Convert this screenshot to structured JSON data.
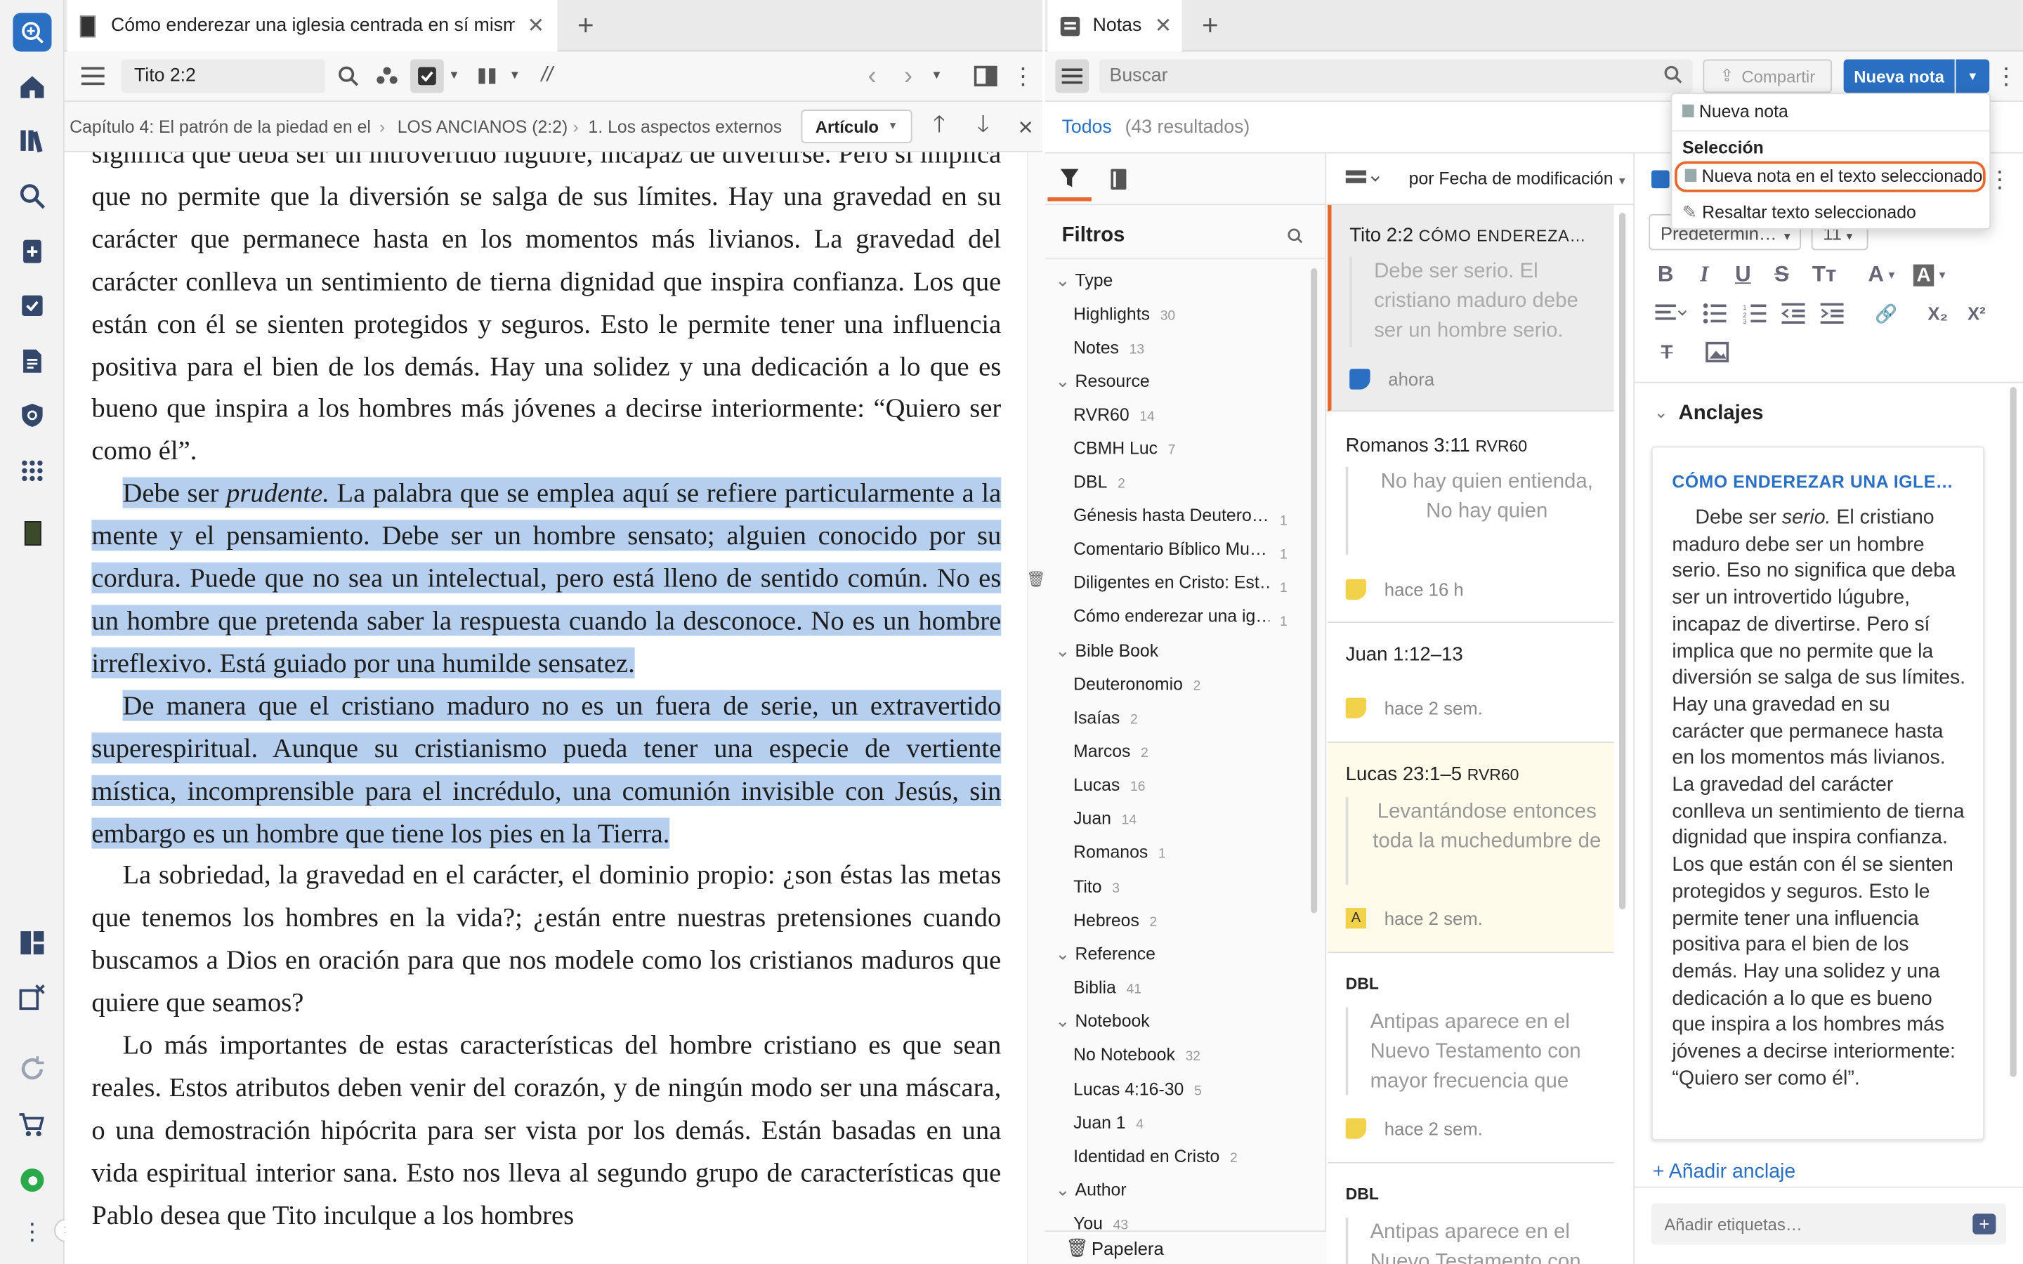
{
  "left_tab": {
    "title": "Cómo enderezar una iglesia centrada en sí misma"
  },
  "reader_toolbar": {
    "reference": "Tito 2:2",
    "parallel": "//"
  },
  "breadcrumb": {
    "items": [
      "Capítulo 4: El patrón de la piedad en el",
      "LOS ANCIANOS (2:2)",
      "1. Los aspectos externos"
    ],
    "view_select": "Artículo"
  },
  "reader": {
    "p1": "significa que deba ser un introvertido lúgubre, incapaz de divertirse. Pero si implica que no permite que la diversión se salga de sus límites. Hay una gravedad en su carácter que permanece hasta en los momentos más livianos. La gravedad del carácter conlleva un sentimiento de tierna dignidad que inspira confianza. Los que están con él se sienten protegidos y seguros. Esto le permite tener una influencia positiva para el bien de los demás. Hay una solidez y una dedicación a lo que es bueno que inspira a los hombres más jóvenes a decirse interiormente: “Quiero ser como él”.",
    "p2a": "Debe ser ",
    "p2em": "prudente.",
    "p2b": " La palabra que se emplea aquí se refiere particularmente a la mente y el pensamiento. Debe ser un hombre sensato; alguien conocido por su cordura. Puede que no sea un intelectual, pero está lleno de sentido común. No es un hombre que pretenda saber la respuesta cuando la desconoce. No es un hombre irreflexivo. Está guiado por una humilde sensatez.",
    "p3": "De manera que el cristiano maduro no es un fuera de serie, un extravertido superespiritual. Aunque su cristianismo pueda tener una especie de vertiente mística, incomprensible para el incrédulo, una comunión invisible con Jesús, sin embargo es un hombre que tiene los pies en la Tierra.",
    "p4": "La sobriedad, la gravedad en el carácter, el dominio propio: ¿son éstas las metas que tenemos los hombres en la vida?; ¿están entre nuestras pretensiones cuando buscamos a Dios en oración para que nos modele como los cristianos maduros que quiere que seamos?",
    "p5": "Lo más importantes de estas características del hombre cristiano es que sean reales. Estos atributos deben venir del corazón, y de ningún modo ser una máscara, o una demostración hipócrita para ser vista por los demás. Están basadas en una vida espiritual interior sana. Esto nos lleva al segundo grupo de características que Pablo desea que Tito inculque a los hombres"
  },
  "notes_tab": {
    "title": "Notas"
  },
  "notes_toolbar": {
    "search_placeholder": "Buscar",
    "share": "Compartir",
    "new_note": "Nueva nota"
  },
  "notes_header": {
    "all": "Todos",
    "results": "(43 resultados)"
  },
  "sort": {
    "label": "por Fecha de modificación"
  },
  "filters": {
    "title": "Filtros",
    "groups": [
      {
        "name": "Type",
        "items": [
          {
            "label": "Highlights",
            "count": "30"
          },
          {
            "label": "Notes",
            "count": "13"
          }
        ]
      },
      {
        "name": "Resource",
        "items": [
          {
            "label": "RVR60",
            "count": "14"
          },
          {
            "label": "CBMH Luc",
            "count": "7"
          },
          {
            "label": "DBL",
            "count": "2"
          },
          {
            "label": "Génesis hasta Deutero…",
            "count": "1"
          },
          {
            "label": "Comentario Bíblico Mu…",
            "count": "1"
          },
          {
            "label": "Diligentes en Cristo: Est…",
            "count": "1"
          },
          {
            "label": "Cómo enderezar una ig…",
            "count": "1"
          }
        ]
      },
      {
        "name": "Bible Book",
        "items": [
          {
            "label": "Deuteronomio",
            "count": "2"
          },
          {
            "label": "Isaías",
            "count": "2"
          },
          {
            "label": "Marcos",
            "count": "2"
          },
          {
            "label": "Lucas",
            "count": "16"
          },
          {
            "label": "Juan",
            "count": "14"
          },
          {
            "label": "Romanos",
            "count": "1"
          },
          {
            "label": "Tito",
            "count": "3"
          },
          {
            "label": "Hebreos",
            "count": "2"
          }
        ]
      },
      {
        "name": "Reference",
        "items": [
          {
            "label": "Biblia",
            "count": "41"
          }
        ]
      },
      {
        "name": "Notebook",
        "items": [
          {
            "label": "No Notebook",
            "count": "32"
          },
          {
            "label": "Lucas 4:16-30",
            "count": "5"
          },
          {
            "label": "Juan 1",
            "count": "4"
          },
          {
            "label": "Identidad en Cristo",
            "count": "2"
          }
        ]
      },
      {
        "name": "Author",
        "items": [
          {
            "label": "You",
            "count": "43"
          }
        ]
      }
    ],
    "trash": "Papelera"
  },
  "notes": [
    {
      "title": "Tito 2:2",
      "res": "CÓMO ENDEREZA…",
      "quote": "Debe ser serio. El cristiano maduro debe ser un hombre serio.",
      "time": "ahora",
      "swatch": "#2b6fc2"
    },
    {
      "title": "Romanos 3:11",
      "res": "RVR60",
      "quote": "No hay quien entienda, No hay quien",
      "time": "hace 16 h",
      "swatch": "#f3d24b"
    },
    {
      "title": "Juan 1:12–13",
      "res": "",
      "quote": "",
      "time": "hace 2 sem.",
      "swatch": "#f3d24b"
    },
    {
      "title": "Lucas 23:1–5",
      "res": "RVR60",
      "quote": "Levantándose entonces toda la muchedumbre de",
      "time": "hace 2 sem.",
      "swatch": "#f3d24b"
    },
    {
      "title": "",
      "res": "DBL",
      "quote": "Antipas aparece en el Nuevo Testamento con mayor frecuencia que",
      "time": "hace 2 sem.",
      "swatch": "#f3d24b"
    },
    {
      "title": "",
      "res": "DBL",
      "quote": "Antipas aparece en el Nuevo Testamento con",
      "time": "",
      "swatch": "#f3d24b"
    }
  ],
  "editor": {
    "font": "Predetermin…",
    "size": "11",
    "anchors_title": "Anclajes",
    "anchor_resource": "CÓMO ENDEREZAR UNA IGLE…",
    "anchor_text_a": "Debe ser ",
    "anchor_text_em": "serio.",
    "anchor_text_b": " El cristiano maduro debe ser un hombre serio. Eso no significa que deba ser un introvertido lúgubre, incapaz de divertirse. Pero sí implica que no permite que la diversión se salga de sus límites. Hay una gravedad en su carácter que permanece hasta en los momentos más livianos. La gravedad del carácter conlleva un sentimiento de tierna dignidad que inspira confianza. Los que están con él se sienten protegidos y seguros. Esto le permite tener una influencia positiva para el bien de los demás. Hay una solidez y una dedicación a lo que es bueno que inspira a los hombres más jóvenes a decirse interiormente: “Quiero ser como él”.",
    "add_anchor": "+ Añadir anclaje",
    "tags_placeholder": "Añadir etiquetas…"
  },
  "dropdown": {
    "new_note": "Nueva nota",
    "section": "Selección",
    "new_note_selection": "Nueva nota en el texto seleccionado",
    "highlight_selection": "Resaltar texto seleccionado"
  },
  "colors": {
    "accent": "#2b6fc2",
    "highlight": "#b7cfee",
    "menu_focus": "#e8672c"
  }
}
